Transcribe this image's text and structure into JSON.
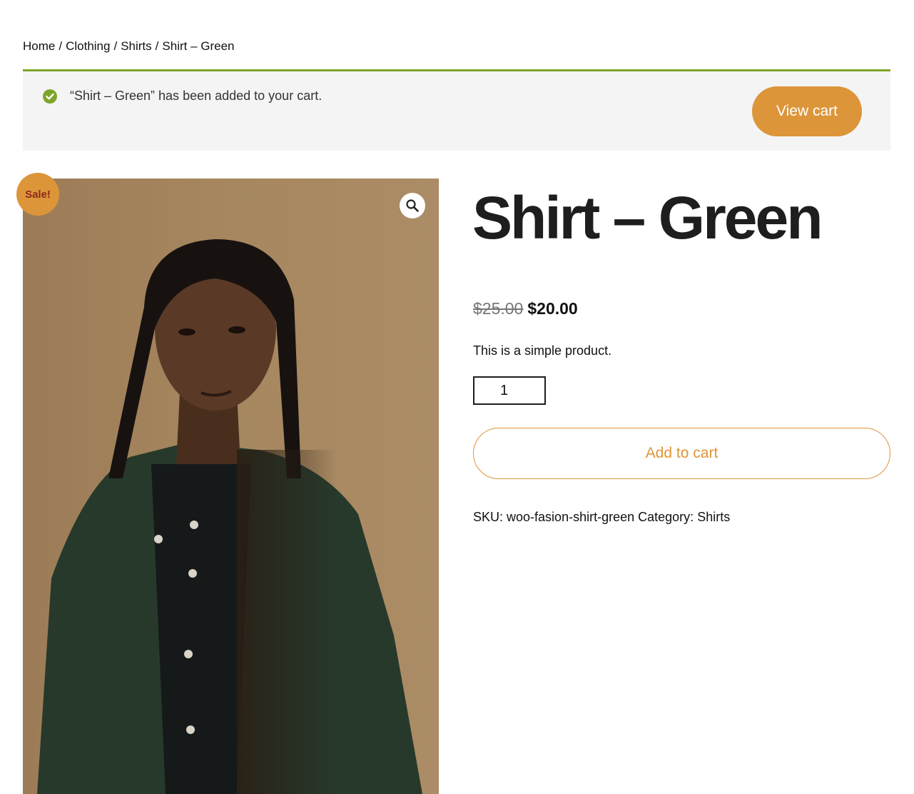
{
  "breadcrumb": {
    "home": "Home",
    "clothing": "Clothing",
    "shirts": "Shirts",
    "current": "Shirt – Green",
    "separator": "/"
  },
  "notice": {
    "message": "“Shirt – Green” has been added to your cart.",
    "button_label": "View cart",
    "accent_color": "#7ea52a"
  },
  "gallery": {
    "sale_badge": "Sale!",
    "zoom_icon": "magnifier-icon"
  },
  "product": {
    "title": "Shirt – Green",
    "price_old": "$25.00",
    "price_new": "$20.00",
    "description": "This is a simple product.",
    "quantity": "1",
    "add_to_cart_label": "Add to cart",
    "sku_label": "SKU:",
    "sku_value": "woo-fasion-shirt-green",
    "category_label": "Category:",
    "category_value": "Shirts"
  },
  "colors": {
    "accent": "#dd9539",
    "success": "#7ea52a"
  }
}
